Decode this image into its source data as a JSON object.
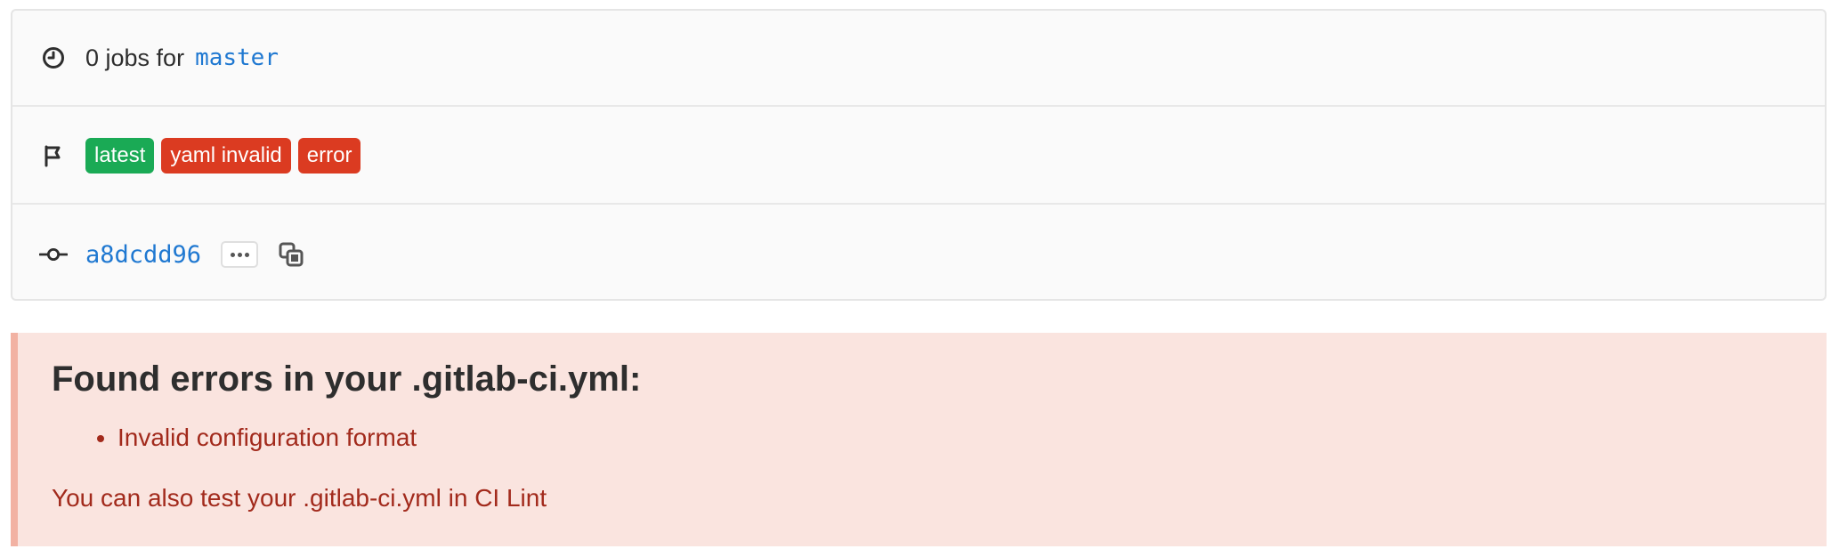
{
  "pipeline_info": {
    "jobs_text": "0 jobs for",
    "branch": "master",
    "badges": [
      {
        "label": "latest",
        "color": "#1aaa55"
      },
      {
        "label": "yaml invalid",
        "color": "#db3b21"
      },
      {
        "label": "error",
        "color": "#db3b21"
      }
    ],
    "commit_sha": "a8dcdd96",
    "ellipsis_label": "•••"
  },
  "alert": {
    "title": "Found errors in your .gitlab-ci.yml:",
    "errors": [
      "Invalid configuration format"
    ],
    "footer_prefix": "You can also test your .gitlab-ci.yml in",
    "footer_link": "CI Lint"
  },
  "colors": {
    "link": "#1f78d1",
    "success": "#1aaa55",
    "danger": "#db3b21",
    "alert_bg": "#fae4df",
    "alert_text": "#a22a1c"
  },
  "icons": {
    "row1": "clock-icon",
    "row2": "flag-icon",
    "row3": "commit-icon",
    "copy": "copy-icon"
  }
}
